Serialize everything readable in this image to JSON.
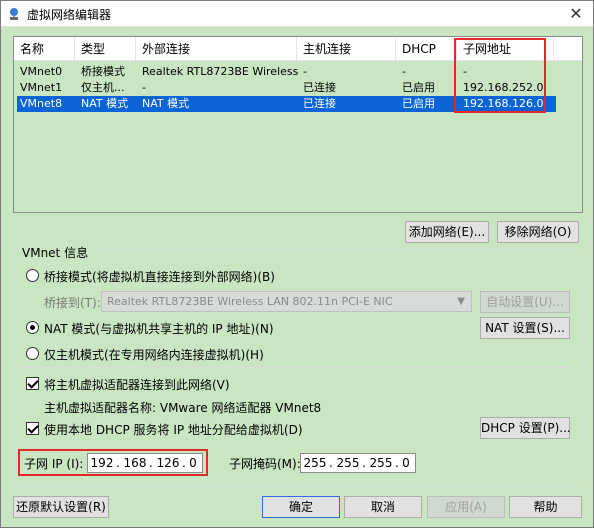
{
  "window": {
    "title": "虚拟网络编辑器",
    "close_symbol": "✕"
  },
  "table": {
    "headers": [
      "名称",
      "类型",
      "外部连接",
      "主机连接",
      "DHCP",
      "子网地址"
    ],
    "rows": [
      [
        "VMnet0",
        "桥接模式",
        "Realtek RTL8723BE Wireless...",
        "-",
        "-",
        "-"
      ],
      [
        "VMnet1",
        "仅主机...",
        "-",
        "已连接",
        "已启用",
        "192.168.252.0"
      ],
      [
        "VMnet8",
        "NAT 模式",
        "NAT 模式",
        "已连接",
        "已启用",
        "192.168.126.0"
      ]
    ],
    "selected_row": 2
  },
  "buttons": {
    "add_network": "添加网络(E)...",
    "remove_network": "移除网络(O)",
    "auto_settings": "自动设置(U)...",
    "nat_settings": "NAT 设置(S)...",
    "dhcp_settings": "DHCP 设置(P)...",
    "restore_defaults": "还原默认设置(R)",
    "ok": "确定",
    "cancel": "取消",
    "apply": "应用(A)",
    "help": "帮助"
  },
  "vmnet_info": {
    "legend": "VMnet 信息",
    "bridged_label": "桥接模式(将虚拟机直接连接到外部网络)(B)",
    "bridged_to_label": "桥接到(T):",
    "bridged_to_value": "Realtek RTL8723BE Wireless LAN 802.11n PCI-E NIC",
    "nat_label": "NAT 模式(与虚拟机共享主机的 IP 地址)(N)",
    "hostonly_label": "仅主机模式(在专用网络内连接虚拟机)(H)",
    "selected_mode": "nat",
    "connect_adapter_label": "将主机虚拟适配器连接到此网络(V)",
    "connect_adapter_checked": true,
    "adapter_name_label": "主机虚拟适配器名称: VMware 网络适配器 VMnet8",
    "dhcp_label": "使用本地 DHCP 服务将 IP 地址分配给虚拟机(D)",
    "dhcp_checked": true,
    "subnet_ip_label": "子网 IP (I):",
    "subnet_ip": [
      "192",
      "168",
      "126",
      "0"
    ],
    "subnet_mask_label": "子网掩码(M):",
    "subnet_mask": [
      "255",
      "255",
      "255",
      "0"
    ]
  },
  "colors": {
    "selection": "#0a64d8",
    "highlight": "#e02a2a",
    "background": "#c9e5c2"
  }
}
